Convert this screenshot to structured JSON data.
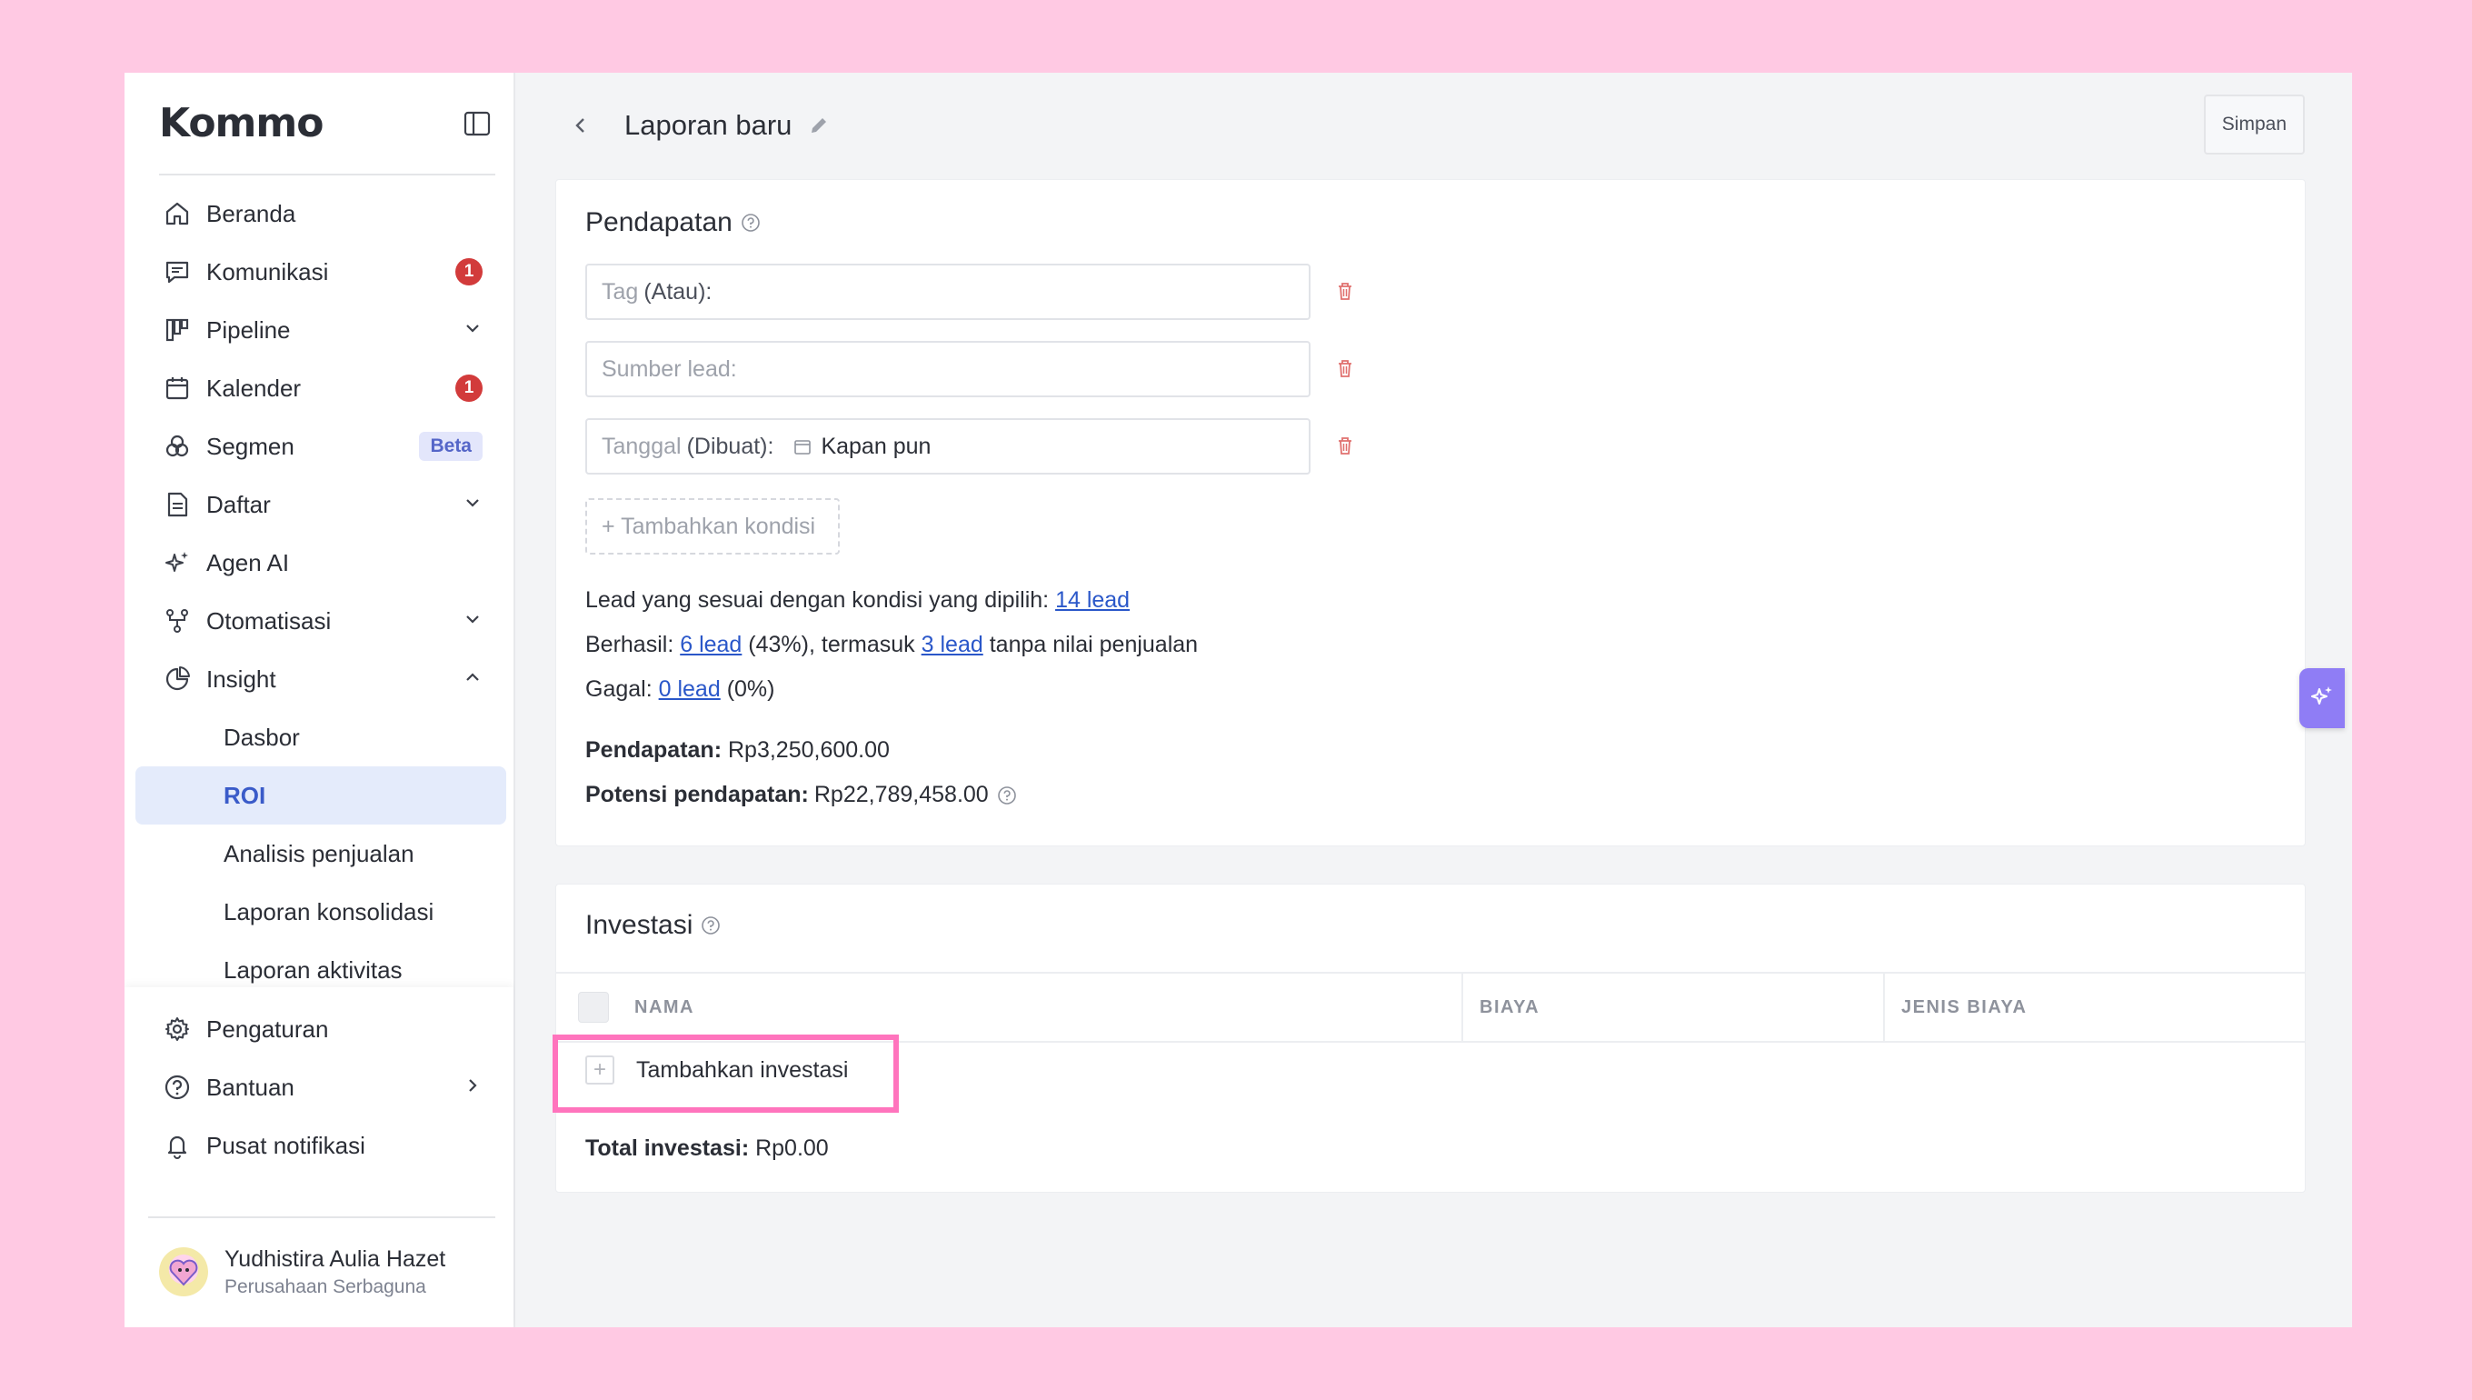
{
  "sidebar": {
    "logo": "Kommo",
    "items": [
      {
        "label": "Beranda",
        "icon": "home-icon"
      },
      {
        "label": "Komunikasi",
        "icon": "chat-icon",
        "badge": "1"
      },
      {
        "label": "Pipeline",
        "icon": "kanban-icon",
        "chevron": "down"
      },
      {
        "label": "Kalender",
        "icon": "calendar-icon",
        "badge": "1"
      },
      {
        "label": "Segmen",
        "icon": "segments-icon",
        "beta": "Beta"
      },
      {
        "label": "Daftar",
        "icon": "list-document-icon",
        "chevron": "down"
      },
      {
        "label": "Agen AI",
        "icon": "sparkle-icon"
      },
      {
        "label": "Otomatisasi",
        "icon": "automation-icon",
        "chevron": "down"
      },
      {
        "label": "Insight",
        "icon": "pie-chart-icon",
        "chevron": "up"
      }
    ],
    "insight_sub": [
      "Dasbor",
      "ROI",
      "Analisis penjualan",
      "Laporan konsolidasi",
      "Laporan aktivitas"
    ],
    "bottom": [
      {
        "label": "Pengaturan",
        "icon": "gear-icon"
      },
      {
        "label": "Bantuan",
        "icon": "help-circle-icon"
      },
      {
        "label": "Pusat notifikasi",
        "icon": "bell-icon"
      }
    ],
    "user": {
      "name": "Yudhistira Aulia Hazet",
      "company": "Perusahaan Serbaguna"
    }
  },
  "topbar": {
    "title": "Laporan baru",
    "save": "Simpan"
  },
  "revenue": {
    "title": "Pendapatan",
    "filters": {
      "tag_label": "Tag",
      "tag_op": "(Atau):",
      "source_label": "Sumber lead:",
      "date_label": "Tanggal",
      "date_op": "(Dibuat):",
      "date_value": "Kapan pun"
    },
    "add_condition": "+ Tambahkan kondisi",
    "matching_text": "Lead yang sesuai dengan kondisi yang dipilih:",
    "matching_link": "14 lead",
    "success_prefix": "Berhasil:",
    "success_link": "6 lead",
    "success_mid": "(43%), termasuk",
    "success_link2": "3 lead",
    "success_suffix": "tanpa nilai penjualan",
    "failed_prefix": "Gagal:",
    "failed_link": "0 lead",
    "failed_suffix": "(0%)",
    "revenue_label": "Pendapatan:",
    "revenue_value": "Rp3,250,600.00",
    "potential_label": "Potensi pendapatan:",
    "potential_value": "Rp22,789,458.00"
  },
  "investment": {
    "title": "Investasi",
    "columns": [
      "NAMA",
      "BIAYA",
      "JENIS BIAYA"
    ],
    "add": "Tambahkan investasi",
    "total_label": "Total investasi:",
    "total_value": "Rp0.00"
  },
  "colors": {
    "accent": "#3a5bc9",
    "highlight": "#ff74bd",
    "background": "#ffc9e3",
    "badge": "#d23b3b"
  }
}
